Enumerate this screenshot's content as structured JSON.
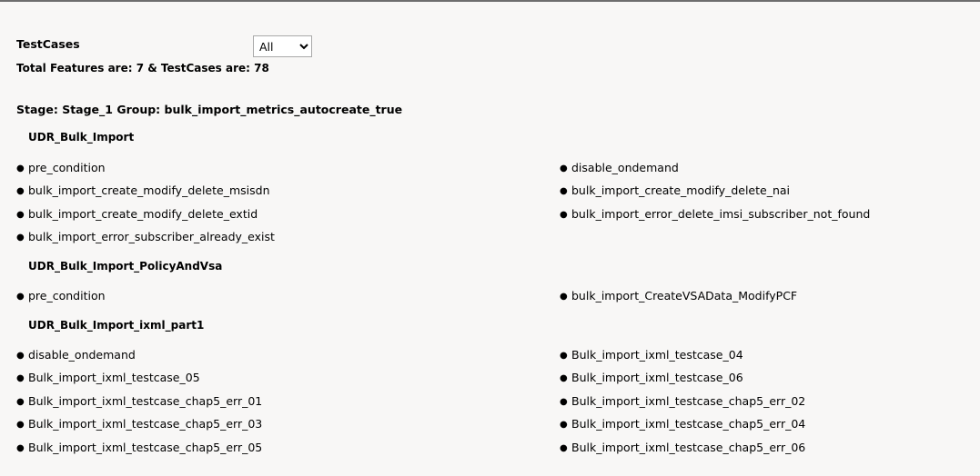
{
  "header": {
    "title": "TestCases",
    "filter": {
      "selected": "All"
    },
    "summary": "Total Features are: 7 & TestCases are: 78"
  },
  "stage": {
    "title": "Stage: Stage_1 Group: bulk_import_metrics_autocreate_true"
  },
  "features": [
    {
      "name": "UDR_Bulk_Import",
      "testcases": [
        "pre_condition",
        "disable_ondemand",
        "bulk_import_create_modify_delete_msisdn",
        "bulk_import_create_modify_delete_nai",
        "bulk_import_create_modify_delete_extid",
        "bulk_import_error_delete_imsi_subscriber_not_found",
        "bulk_import_error_subscriber_already_exist"
      ]
    },
    {
      "name": "UDR_Bulk_Import_PolicyAndVsa",
      "testcases": [
        "pre_condition",
        "bulk_import_CreateVSAData_ModifyPCF"
      ]
    },
    {
      "name": "UDR_Bulk_Import_ixml_part1",
      "testcases": [
        "disable_ondemand",
        "Bulk_import_ixml_testcase_04",
        "Bulk_import_ixml_testcase_05",
        "Bulk_import_ixml_testcase_06",
        "Bulk_import_ixml_testcase_chap5_err_01",
        "Bulk_import_ixml_testcase_chap5_err_02",
        "Bulk_import_ixml_testcase_chap5_err_03",
        "Bulk_import_ixml_testcase_chap5_err_04",
        "Bulk_import_ixml_testcase_chap5_err_05",
        "Bulk_import_ixml_testcase_chap5_err_06"
      ]
    }
  ]
}
